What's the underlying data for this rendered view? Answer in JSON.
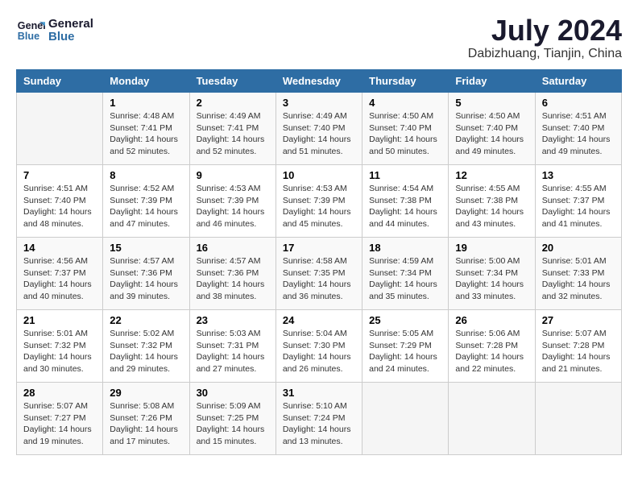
{
  "header": {
    "logo_line1": "General",
    "logo_line2": "Blue",
    "month_year": "July 2024",
    "location": "Dabizhuang, Tianjin, China"
  },
  "days_of_week": [
    "Sunday",
    "Monday",
    "Tuesday",
    "Wednesday",
    "Thursday",
    "Friday",
    "Saturday"
  ],
  "weeks": [
    [
      {
        "day": "",
        "detail": ""
      },
      {
        "day": "1",
        "detail": "Sunrise: 4:48 AM\nSunset: 7:41 PM\nDaylight: 14 hours\nand 52 minutes."
      },
      {
        "day": "2",
        "detail": "Sunrise: 4:49 AM\nSunset: 7:41 PM\nDaylight: 14 hours\nand 52 minutes."
      },
      {
        "day": "3",
        "detail": "Sunrise: 4:49 AM\nSunset: 7:40 PM\nDaylight: 14 hours\nand 51 minutes."
      },
      {
        "day": "4",
        "detail": "Sunrise: 4:50 AM\nSunset: 7:40 PM\nDaylight: 14 hours\nand 50 minutes."
      },
      {
        "day": "5",
        "detail": "Sunrise: 4:50 AM\nSunset: 7:40 PM\nDaylight: 14 hours\nand 49 minutes."
      },
      {
        "day": "6",
        "detail": "Sunrise: 4:51 AM\nSunset: 7:40 PM\nDaylight: 14 hours\nand 49 minutes."
      }
    ],
    [
      {
        "day": "7",
        "detail": "Sunrise: 4:51 AM\nSunset: 7:40 PM\nDaylight: 14 hours\nand 48 minutes."
      },
      {
        "day": "8",
        "detail": "Sunrise: 4:52 AM\nSunset: 7:39 PM\nDaylight: 14 hours\nand 47 minutes."
      },
      {
        "day": "9",
        "detail": "Sunrise: 4:53 AM\nSunset: 7:39 PM\nDaylight: 14 hours\nand 46 minutes."
      },
      {
        "day": "10",
        "detail": "Sunrise: 4:53 AM\nSunset: 7:39 PM\nDaylight: 14 hours\nand 45 minutes."
      },
      {
        "day": "11",
        "detail": "Sunrise: 4:54 AM\nSunset: 7:38 PM\nDaylight: 14 hours\nand 44 minutes."
      },
      {
        "day": "12",
        "detail": "Sunrise: 4:55 AM\nSunset: 7:38 PM\nDaylight: 14 hours\nand 43 minutes."
      },
      {
        "day": "13",
        "detail": "Sunrise: 4:55 AM\nSunset: 7:37 PM\nDaylight: 14 hours\nand 41 minutes."
      }
    ],
    [
      {
        "day": "14",
        "detail": "Sunrise: 4:56 AM\nSunset: 7:37 PM\nDaylight: 14 hours\nand 40 minutes."
      },
      {
        "day": "15",
        "detail": "Sunrise: 4:57 AM\nSunset: 7:36 PM\nDaylight: 14 hours\nand 39 minutes."
      },
      {
        "day": "16",
        "detail": "Sunrise: 4:57 AM\nSunset: 7:36 PM\nDaylight: 14 hours\nand 38 minutes."
      },
      {
        "day": "17",
        "detail": "Sunrise: 4:58 AM\nSunset: 7:35 PM\nDaylight: 14 hours\nand 36 minutes."
      },
      {
        "day": "18",
        "detail": "Sunrise: 4:59 AM\nSunset: 7:34 PM\nDaylight: 14 hours\nand 35 minutes."
      },
      {
        "day": "19",
        "detail": "Sunrise: 5:00 AM\nSunset: 7:34 PM\nDaylight: 14 hours\nand 33 minutes."
      },
      {
        "day": "20",
        "detail": "Sunrise: 5:01 AM\nSunset: 7:33 PM\nDaylight: 14 hours\nand 32 minutes."
      }
    ],
    [
      {
        "day": "21",
        "detail": "Sunrise: 5:01 AM\nSunset: 7:32 PM\nDaylight: 14 hours\nand 30 minutes."
      },
      {
        "day": "22",
        "detail": "Sunrise: 5:02 AM\nSunset: 7:32 PM\nDaylight: 14 hours\nand 29 minutes."
      },
      {
        "day": "23",
        "detail": "Sunrise: 5:03 AM\nSunset: 7:31 PM\nDaylight: 14 hours\nand 27 minutes."
      },
      {
        "day": "24",
        "detail": "Sunrise: 5:04 AM\nSunset: 7:30 PM\nDaylight: 14 hours\nand 26 minutes."
      },
      {
        "day": "25",
        "detail": "Sunrise: 5:05 AM\nSunset: 7:29 PM\nDaylight: 14 hours\nand 24 minutes."
      },
      {
        "day": "26",
        "detail": "Sunrise: 5:06 AM\nSunset: 7:28 PM\nDaylight: 14 hours\nand 22 minutes."
      },
      {
        "day": "27",
        "detail": "Sunrise: 5:07 AM\nSunset: 7:28 PM\nDaylight: 14 hours\nand 21 minutes."
      }
    ],
    [
      {
        "day": "28",
        "detail": "Sunrise: 5:07 AM\nSunset: 7:27 PM\nDaylight: 14 hours\nand 19 minutes."
      },
      {
        "day": "29",
        "detail": "Sunrise: 5:08 AM\nSunset: 7:26 PM\nDaylight: 14 hours\nand 17 minutes."
      },
      {
        "day": "30",
        "detail": "Sunrise: 5:09 AM\nSunset: 7:25 PM\nDaylight: 14 hours\nand 15 minutes."
      },
      {
        "day": "31",
        "detail": "Sunrise: 5:10 AM\nSunset: 7:24 PM\nDaylight: 14 hours\nand 13 minutes."
      },
      {
        "day": "",
        "detail": ""
      },
      {
        "day": "",
        "detail": ""
      },
      {
        "day": "",
        "detail": ""
      }
    ]
  ]
}
